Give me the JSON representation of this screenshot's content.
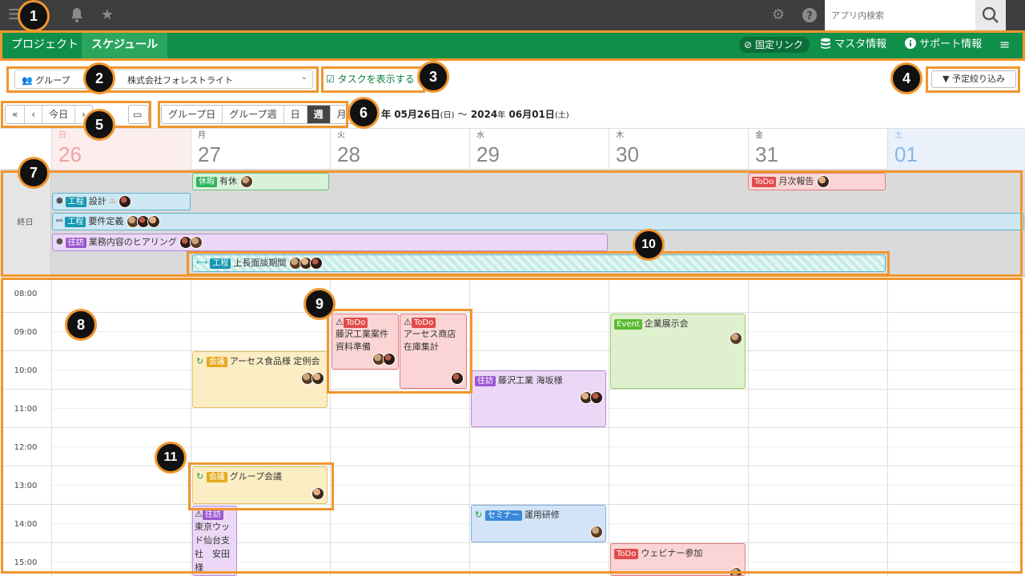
{
  "topbar": {
    "search_placeholder": "アプリ内検索"
  },
  "nav": {
    "tabs": [
      {
        "label": "プロジェクト"
      },
      {
        "label": "スケジュール"
      }
    ],
    "fixed_link": "固定リンク",
    "master": "マスタ情報",
    "support": "サポート情報"
  },
  "filter": {
    "group_label": "グループ",
    "company": "株式会社フォレストライト",
    "show_tasks": "タスクを表示する",
    "filter_btn": "予定絞り込み"
  },
  "toolbar": {
    "today": "今日",
    "views": [
      "グループ日",
      "グループ週",
      "日",
      "週",
      "月"
    ],
    "active_view": "週",
    "range_year_start": "年",
    "range_start": "05月26日",
    "range_start_wd": "(日)",
    "range_sep": "～",
    "range_end_year": "2024",
    "range_end_year_unit": "年",
    "range_end": "06月01日",
    "range_end_wd": "(土)"
  },
  "days": [
    {
      "wd": "日",
      "num": "26"
    },
    {
      "wd": "月",
      "num": "27"
    },
    {
      "wd": "火",
      "num": "28"
    },
    {
      "wd": "水",
      "num": "29"
    },
    {
      "wd": "木",
      "num": "30"
    },
    {
      "wd": "金",
      "num": "31"
    },
    {
      "wd": "土",
      "num": "01"
    }
  ],
  "allday": {
    "label": "終日",
    "events": [
      {
        "badge": "休暇",
        "title": "有休"
      },
      {
        "badge": "ToDo",
        "title": "月次報告"
      },
      {
        "badge": "工程",
        "title": "設計"
      },
      {
        "badge": "工程",
        "title": "要件定義"
      },
      {
        "badge": "往訪",
        "title": "業務内容のヒアリング"
      },
      {
        "badge": "工程",
        "title": "上長面談期間"
      }
    ]
  },
  "times": [
    "08:00",
    "09:00",
    "10:00",
    "11:00",
    "12:00",
    "13:00",
    "14:00",
    "15:00"
  ],
  "events": {
    "todo1": {
      "badge": "ToDo",
      "title": "藤沢工業案件資料準備"
    },
    "todo2": {
      "badge": "ToDo",
      "title": "アーセス商店在庫集計"
    },
    "event1": {
      "badge": "Event",
      "title": "企業展示会"
    },
    "meeting1": {
      "badge": "会議",
      "title": "アーセス食品様 定例会"
    },
    "visit1": {
      "badge": "往訪",
      "title": "藤沢工業 海坂様"
    },
    "meeting2": {
      "badge": "会議",
      "title": "グループ会議"
    },
    "visit2": {
      "badge": "往訪",
      "title": "東京ウッド仙台支社　安田様"
    },
    "seminar": {
      "badge": "セミナー",
      "title": "運用研修"
    },
    "todo3": {
      "badge": "ToDo",
      "title": "ウェビナー参加"
    }
  },
  "markers": [
    "1",
    "2",
    "3",
    "4",
    "5",
    "6",
    "7",
    "8",
    "9",
    "10",
    "11"
  ],
  "colors": {
    "nav": "#0f8f4a",
    "callout": "#f0962e"
  }
}
